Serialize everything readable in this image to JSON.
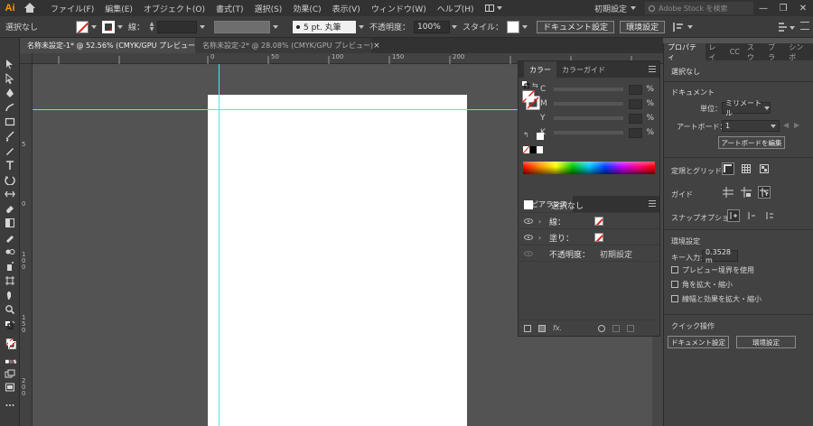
{
  "app": {
    "logo": "Ai"
  },
  "menubar": {
    "items": [
      "ファイル(F)",
      "編集(E)",
      "オブジェクト(O)",
      "書式(T)",
      "選択(S)",
      "効果(C)",
      "表示(V)",
      "ウィンドウ(W)",
      "ヘルプ(H)"
    ],
    "workspace": "初期設定",
    "stock_search_placeholder": "Adobe Stock を検索",
    "window_controls": [
      "—",
      "❐",
      "✕"
    ]
  },
  "controlbar": {
    "selection_status": "選択なし",
    "stroke_label": "線：",
    "brush": "5 pt. 丸筆",
    "opacity_label": "不透明度：",
    "opacity_value": "100%",
    "style_label": "スタイル：",
    "document_setup_button": "ドキュメント設定",
    "preferences_button": "環境設定"
  },
  "tabs": [
    {
      "label": "名称未設定-1* @ 52.56% (CMYK/GPU プレビュー)",
      "active": true,
      "close": "×"
    },
    {
      "label": "名称未設定-2* @ 28.08% (CMYK/GPU プレビュー)",
      "active": false,
      "close": "×"
    }
  ],
  "ruler": {
    "h_ticks": [
      "0",
      "50",
      "100",
      "150",
      "200"
    ],
    "v_ticks": [
      "5",
      "0",
      "1\n0\n0",
      "1\n5\n0",
      "2\n0\n0",
      "2\n5\n0"
    ]
  },
  "color_panel": {
    "tabs": [
      "カラー",
      "カラーガイド"
    ],
    "channels": [
      {
        "letter": "C",
        "unit": "%"
      },
      {
        "letter": "M",
        "unit": "%"
      },
      {
        "letter": "Y",
        "unit": "%"
      },
      {
        "letter": "K",
        "unit": "%"
      }
    ]
  },
  "appearance_panel": {
    "tab": "アピアランス",
    "title": "選択なし",
    "rows": [
      {
        "label": "線："
      },
      {
        "label": "塗り："
      }
    ],
    "opacity_label": "不透明度：",
    "opacity_value": "初期設定"
  },
  "properties_panel": {
    "tabs": [
      "プロパティ",
      "レイ",
      "CC",
      "スウ",
      "ブラ",
      "シンボ"
    ],
    "selection": "選択なし",
    "document_heading": "ドキュメント",
    "unit_label": "単位：",
    "unit_value": "ミリメートル",
    "artboard_label": "アートボード：",
    "artboard_value": "1",
    "artboard_edit_button": "アートボードを編集",
    "rulers_grids_label": "定規とグリッド",
    "guides_label": "ガイド",
    "snap_label": "スナップオプション",
    "prefs_heading": "環境設定",
    "key_input_label": "キー入力：",
    "key_input_value": "0.3528 m",
    "checkboxes": [
      "プレビュー境界を使用",
      "角を拡大・縮小",
      "線幅と効果を拡大・縮小"
    ],
    "quick_actions_heading": "クイック操作",
    "document_setup_button": "ドキュメント設定",
    "preferences_button": "環境設定"
  },
  "colors": {
    "guide": "#4fe8ec",
    "accent_logo": "#ff9a00",
    "none_slash": "#e0201c"
  }
}
